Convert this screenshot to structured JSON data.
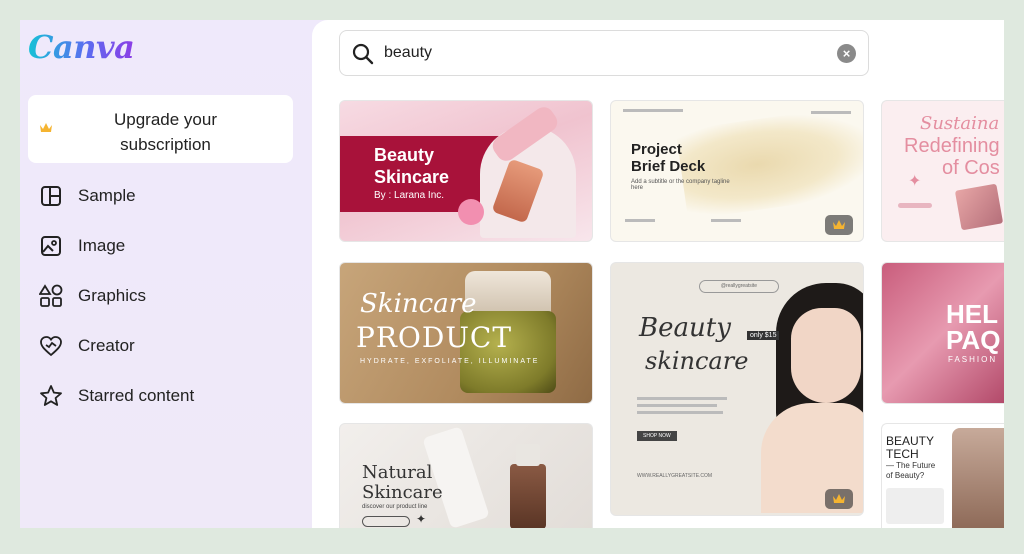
{
  "app": {
    "logo": "Canva"
  },
  "sidebar": {
    "upgrade": {
      "label": "Upgrade your subscription",
      "line1": "Upgrade your",
      "line2": "subscription",
      "icon": "crown-icon"
    },
    "items": [
      {
        "label": "Sample",
        "icon": "sample-layout-icon"
      },
      {
        "label": "Image",
        "icon": "image-icon"
      },
      {
        "label": "Graphics",
        "icon": "graphics-shapes-icon"
      },
      {
        "label": "Creator",
        "icon": "creator-heart-icon"
      },
      {
        "label": "Starred content",
        "icon": "star-icon"
      }
    ]
  },
  "search": {
    "value": "beauty",
    "clear_icon": "close-icon"
  },
  "templates": {
    "t1": {
      "title1": "Beauty",
      "title2": "Skincare",
      "byline": "By : Larana Inc."
    },
    "t2": {
      "title1": "Project",
      "title2": "Brief Deck",
      "subtitle": "Add a subtitle or the company tagline here",
      "premium": true
    },
    "t3": {
      "line1": "Sustaina",
      "line2": "Redefining",
      "line3": "of Cos"
    },
    "t4": {
      "script": "Skincare",
      "title": "PRODUCT",
      "tagline": "HYDRATE, EXFOLIATE, ILLUMINATE"
    },
    "t5": {
      "tag": "@reallygreatsite",
      "script1": "Beauty",
      "script2": "skincare",
      "price": "only $15",
      "cta": "SHOP NOW",
      "url": "WWW.REALLYGREATSITE.COM",
      "premium": true
    },
    "t6": {
      "title1": "HEL",
      "title2": "PAQ",
      "subtitle": "FASHION"
    },
    "t7": {
      "script1": "Natural",
      "script2": "Skincare",
      "sub": "discover our product line"
    },
    "t8": {
      "title1": "BEAUTY",
      "title2": "TECH",
      "sub1": "— The Future",
      "sub2": "of Beauty?"
    }
  },
  "colors": {
    "accent": "#7d2ae8",
    "window_bg": "#efe9fb",
    "premium_crown": "#f5b431"
  }
}
